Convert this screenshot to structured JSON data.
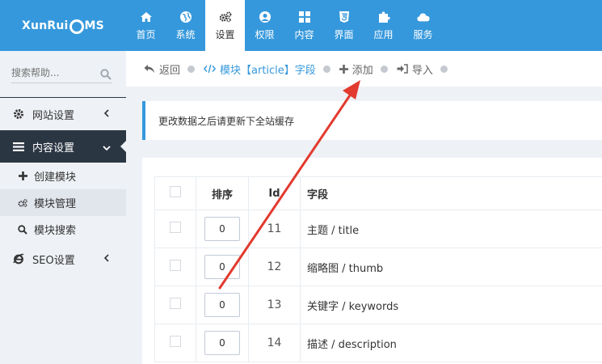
{
  "brand": {
    "before": "XunRui",
    "after": "MS"
  },
  "nav": [
    {
      "label": "首页",
      "icon": "home-icon"
    },
    {
      "label": "系统",
      "icon": "globe-icon"
    },
    {
      "label": "设置",
      "icon": "gears-icon",
      "active": true
    },
    {
      "label": "权限",
      "icon": "user-circle-icon"
    },
    {
      "label": "内容",
      "icon": "grid-icon"
    },
    {
      "label": "界面",
      "icon": "html5-icon"
    },
    {
      "label": "应用",
      "icon": "puzzle-icon"
    },
    {
      "label": "服务",
      "icon": "cloud-icon"
    }
  ],
  "sidebar": {
    "search_placeholder": "搜索帮助...",
    "items": [
      {
        "label": "网站设置",
        "icon": "gear-icon"
      },
      {
        "label": "内容设置",
        "icon": "bars-icon",
        "active": true
      },
      {
        "label": "创建模块",
        "icon": "plus-icon"
      },
      {
        "label": "模块管理",
        "icon": "gears-icon"
      },
      {
        "label": "模块搜索",
        "icon": "search-icon"
      },
      {
        "label": "SEO设置",
        "icon": "ie-icon"
      }
    ]
  },
  "toolbar": {
    "back": "返回",
    "module_field": "模块【article】字段",
    "add": "添加",
    "import": "导入"
  },
  "notice": "更改数据之后请更新下全站缓存",
  "table": {
    "headers": {
      "order": "排序",
      "id": "Id",
      "field": "字段"
    },
    "rows": [
      {
        "order": "0",
        "id": "11",
        "field": "主题 / title"
      },
      {
        "order": "0",
        "id": "12",
        "field": "缩略图 / thumb"
      },
      {
        "order": "0",
        "id": "13",
        "field": "关键字 / keywords"
      },
      {
        "order": "0",
        "id": "14",
        "field": "描述 / description"
      }
    ]
  },
  "colors": {
    "primary": "#3598dc",
    "sidebar_active": "#2b3643",
    "arrow": "#e23a2e"
  }
}
